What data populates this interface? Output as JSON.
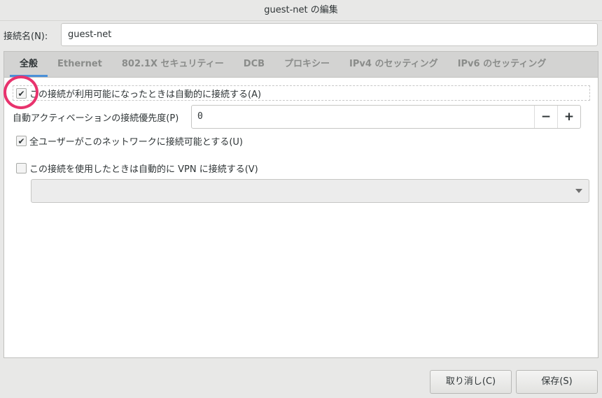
{
  "window": {
    "title": "guest-net の編集"
  },
  "name": {
    "label": "接続名(N):",
    "value": "guest-net"
  },
  "tabs": [
    "全般",
    "Ethernet",
    "802.1X セキュリティー",
    "DCB",
    "プロキシー",
    "IPv4 のセッティング",
    "IPv6 のセッティング"
  ],
  "general": {
    "auto_connect": {
      "label": "この接続が利用可能になったときは自動的に接続する(A)",
      "checked": true
    },
    "priority": {
      "label": "自動アクティベーションの接続優先度(P)",
      "value": "0",
      "minus": "−",
      "plus": "+"
    },
    "all_users": {
      "label": "全ユーザーがこのネットワークに接続可能とする(U)",
      "checked": true
    },
    "auto_vpn": {
      "label": "この接続を使用したときは自動的に VPN に接続する(V)",
      "checked": false
    },
    "vpn_select": {
      "value": ""
    }
  },
  "footer": {
    "cancel": "取り消し(C)",
    "save": "保存(S)"
  },
  "annotation_color": "#e8336d"
}
